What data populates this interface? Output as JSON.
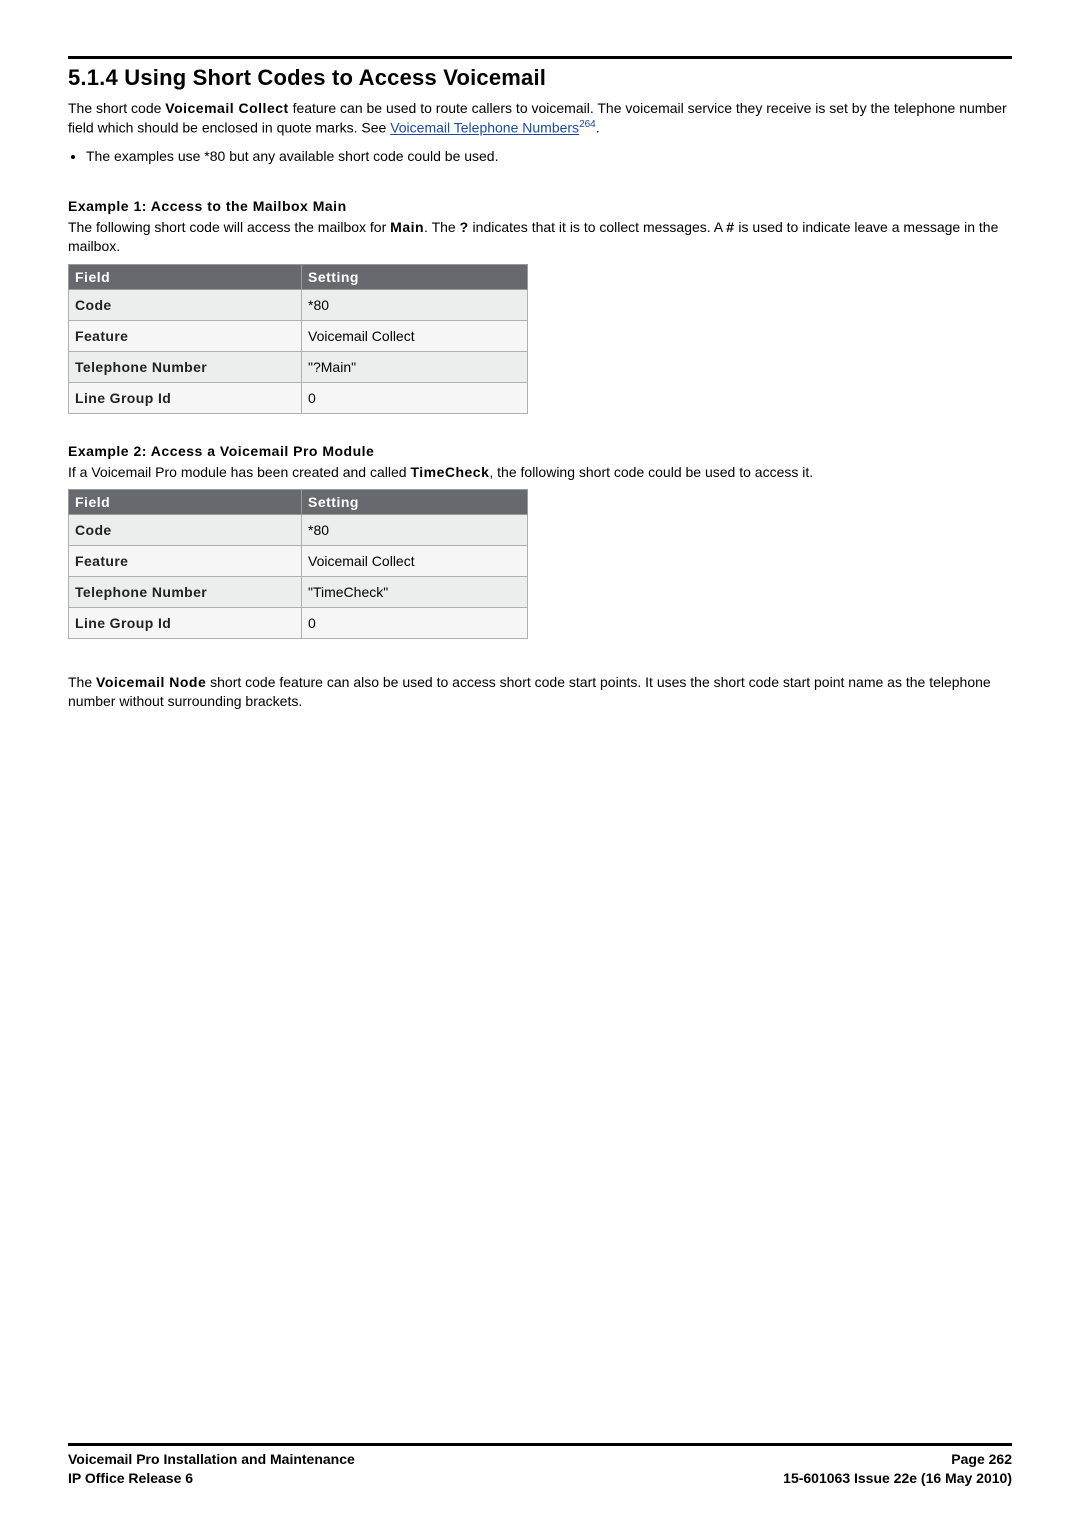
{
  "section_number": "5.1.4 Using Short Codes to Access Voicemail",
  "intro_part1": "The short code ",
  "intro_feature": "Voicemail Collect",
  "intro_part2": " feature can be used to route callers to voicemail. The voicemail service they receive is set by the telephone number field which should be enclosed in quote marks. See ",
  "intro_link_text": "Voicemail Telephone Numbers",
  "intro_link_ref": "264",
  "intro_part3": ".",
  "bullet1": "The examples use *80 but any available short code could be used.",
  "example1_title": "Example 1: Access to the Mailbox Main",
  "example1_body_a": "The following short code will access the mailbox for ",
  "example1_body_main": "Main",
  "example1_body_b": ". The ",
  "example1_body_q": "?",
  "example1_body_c": " indicates that it is to collect messages. A ",
  "example1_body_hash": "#",
  "example1_body_d": " is used to indicate leave a message in the mailbox.",
  "table_headers": {
    "field": "Field",
    "setting": "Setting"
  },
  "table1": [
    {
      "field": "Code",
      "setting": "*80"
    },
    {
      "field": "Feature",
      "setting": "Voicemail Collect"
    },
    {
      "field": "Telephone Number",
      "setting": "\"?Main\""
    },
    {
      "field": "Line Group Id",
      "setting": "0"
    }
  ],
  "example2_title": "Example 2: Access a Voicemail Pro Module",
  "example2_body_a": "If a Voicemail Pro module has been created and called ",
  "example2_body_tc": "TimeCheck",
  "example2_body_b": ", the following short code could be used to access it.",
  "table2": [
    {
      "field": "Code",
      "setting": "*80"
    },
    {
      "field": "Feature",
      "setting": "Voicemail Collect"
    },
    {
      "field": "Telephone Number",
      "setting": "\"TimeCheck\""
    },
    {
      "field": "Line Group Id",
      "setting": "0"
    }
  ],
  "closing_a": "The ",
  "closing_bold": "Voicemail Node",
  "closing_b": " short code feature can also be used to access short code start points. It uses the short code start point name as the telephone number without surrounding brackets.",
  "footer": {
    "left1": "Voicemail Pro Installation and Maintenance",
    "left2": "IP Office Release 6",
    "right1": "Page 262",
    "right2": "15-601063 Issue 22e (16 May 2010)"
  }
}
